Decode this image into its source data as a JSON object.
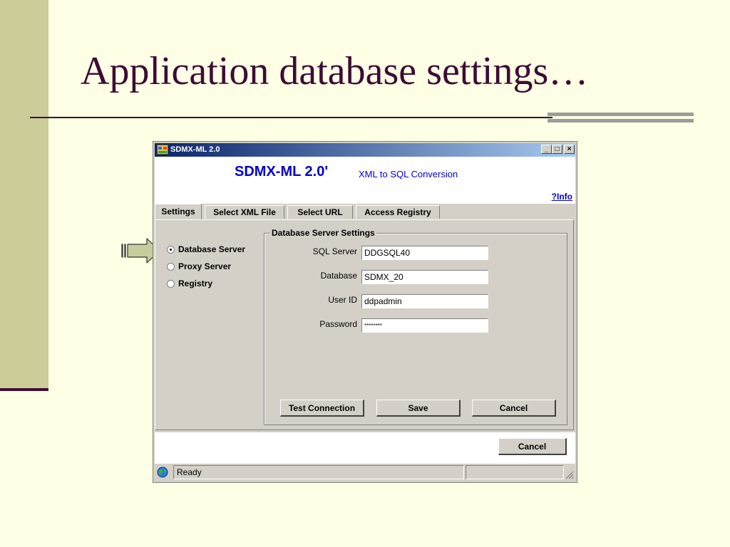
{
  "slide": {
    "title": "Application database settings…"
  },
  "window": {
    "title": "SDMX-ML 2.0",
    "controls": {
      "minimize": "_",
      "maximize": "□",
      "close": "×"
    },
    "header": {
      "app_name": "SDMX-ML 2.0'",
      "subtitle": "XML to SQL Conversion",
      "info_link": "?Info"
    },
    "tabs": [
      {
        "label": "Settings",
        "active": true
      },
      {
        "label": "Select XML File",
        "active": false
      },
      {
        "label": "Select URL",
        "active": false
      },
      {
        "label": "Access Registry",
        "active": false
      }
    ],
    "radio_options": [
      {
        "label": "Database Server",
        "checked": true
      },
      {
        "label": "Proxy Server",
        "checked": false
      },
      {
        "label": "Registry",
        "checked": false
      }
    ],
    "group": {
      "legend": "Database Server Settings",
      "fields": [
        {
          "label": "SQL Server",
          "value": "DDGSQL40"
        },
        {
          "label": "Database",
          "value": "SDMX_20"
        },
        {
          "label": "User ID",
          "value": "ddpadmin"
        },
        {
          "label": "Password",
          "value": "********"
        }
      ],
      "buttons": {
        "test_connection": "Test Connection",
        "save": "Save",
        "cancel": "Cancel"
      }
    },
    "footer": {
      "cancel": "Cancel"
    },
    "status": {
      "text": "Ready"
    }
  },
  "colors": {
    "slide_background": "#FFFFE5",
    "accent_strip": "#CCCC99",
    "title_color": "#3D0C35",
    "titlebar_start": "#0A246A",
    "titlebar_end": "#A6CAF0",
    "window_face": "#D4D0C8",
    "app_blue": "#0000CC",
    "arrow_fill": "#C8CC9A"
  },
  "icons": {
    "app": "app-window-icon",
    "status": "globe-icon",
    "pointer": "right-arrow-icon"
  }
}
